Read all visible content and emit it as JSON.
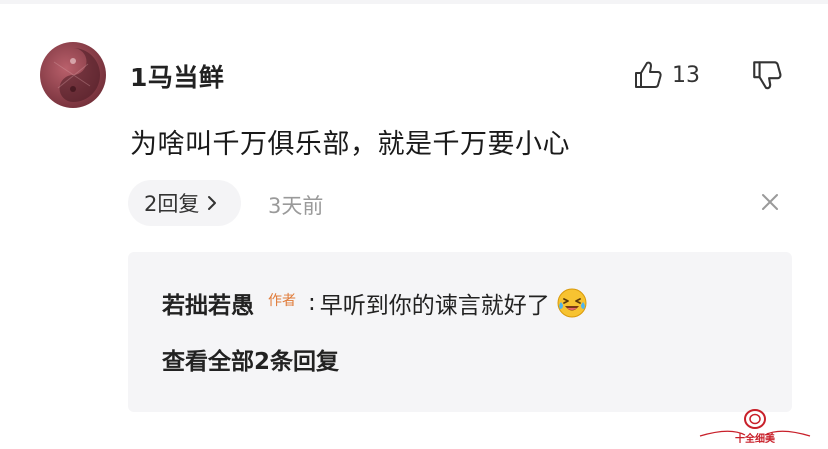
{
  "comment": {
    "username": "1马当鲜",
    "like_count": "13",
    "text": "为啥叫千万俱乐部，就是千万要小心",
    "reply_label": "2回复",
    "timestamp": "3天前"
  },
  "reply_preview": {
    "author": "若拙若愚",
    "author_badge": "作者",
    "separator": ":",
    "text": "早听到你的谏言就好了",
    "emoji": "laughing-crying-emoji",
    "view_all_label": "查看全部2条回复"
  },
  "watermark": {
    "text": "十全细美"
  },
  "icons": {
    "like": "thumb-up-icon",
    "dislike": "thumb-down-icon",
    "chevron": "chevron-right-icon",
    "close": "close-icon"
  },
  "colors": {
    "badge": "#e07b39",
    "muted": "#9a9a9a",
    "reply_bg": "#f5f5f7",
    "pill_bg": "#f4f4f6"
  }
}
